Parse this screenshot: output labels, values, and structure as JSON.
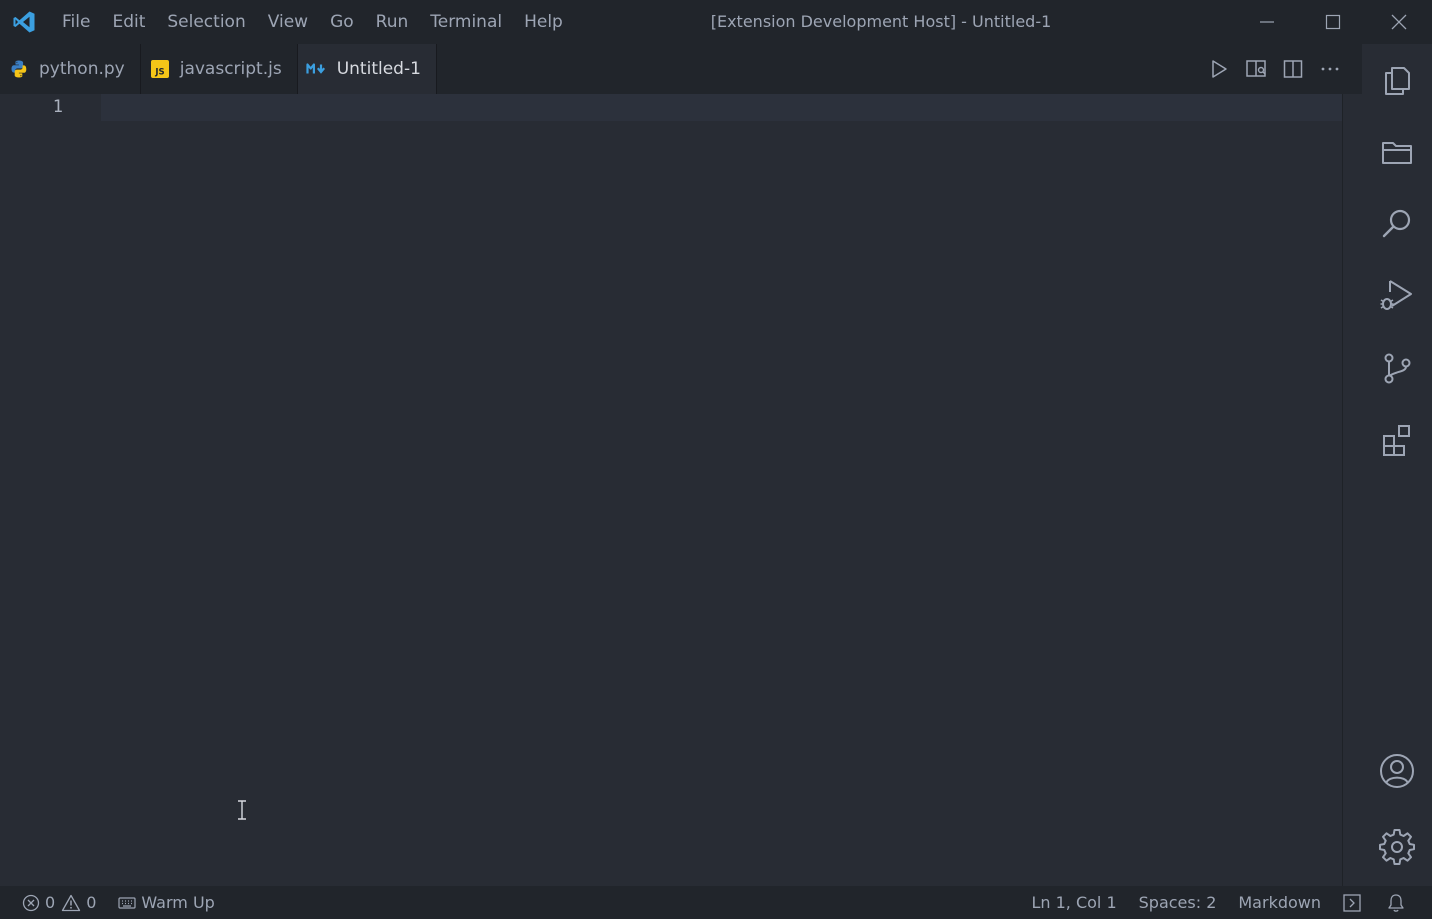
{
  "titlebar": {
    "logo_icon": "vscode-logo-icon",
    "menu": [
      "File",
      "Edit",
      "Selection",
      "View",
      "Go",
      "Run",
      "Terminal",
      "Help"
    ],
    "window_title": "[Extension Development Host] - Untitled-1"
  },
  "tabs": [
    {
      "label": "python.py",
      "icon": "python-file-icon",
      "active": false
    },
    {
      "label": "javascript.js",
      "icon": "javascript-file-icon",
      "active": false
    },
    {
      "label": "Untitled-1",
      "icon": "markdown-file-icon",
      "active": true
    }
  ],
  "editor": {
    "line_numbers": [
      "1"
    ]
  },
  "activitybar": [
    "explorer-icon",
    "folder-icon",
    "search-icon",
    "run-debug-icon",
    "source-control-icon",
    "extensions-icon",
    "account-icon",
    "settings-gear-icon"
  ],
  "statusbar": {
    "errors": "0",
    "warnings": "0",
    "warmup": "Warm Up",
    "position": "Ln 1, Col 1",
    "spaces": "Spaces: 2",
    "language": "Markdown"
  },
  "colors": {
    "accent": "#3b9fe0",
    "editor_bg": "#282c34",
    "chrome_bg": "#21252b"
  }
}
